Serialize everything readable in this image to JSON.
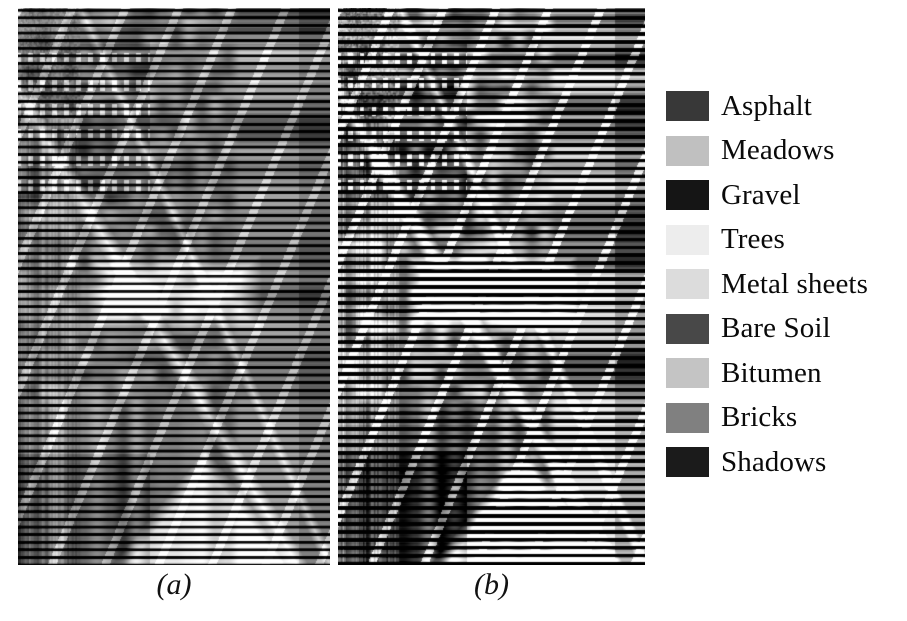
{
  "figure": {
    "panels": [
      {
        "id": "a",
        "caption": "(a)",
        "description": "Pavia University false-colour / ground-truth band image with horizontal striping noise, low contrast"
      },
      {
        "id": "b",
        "caption": "(b)",
        "description": "Pavia University band image with strong horizontal striping noise, high contrast"
      }
    ]
  },
  "legend": {
    "items": [
      {
        "label": "Asphalt",
        "color": "#383838"
      },
      {
        "label": "Meadows",
        "color": "#c0c0c0"
      },
      {
        "label": "Gravel",
        "color": "#151515"
      },
      {
        "label": "Trees",
        "color": "#ededed"
      },
      {
        "label": "Metal sheets",
        "color": "#dcdcdc"
      },
      {
        "label": "Bare Soil",
        "color": "#484848"
      },
      {
        "label": "Bitumen",
        "color": "#c4c4c4"
      },
      {
        "label": "Bricks",
        "color": "#808080"
      },
      {
        "label": "Shadows",
        "color": "#1b1b1b"
      }
    ]
  },
  "colors": {
    "background": "#ffffff",
    "text": "#0a0a0a"
  }
}
